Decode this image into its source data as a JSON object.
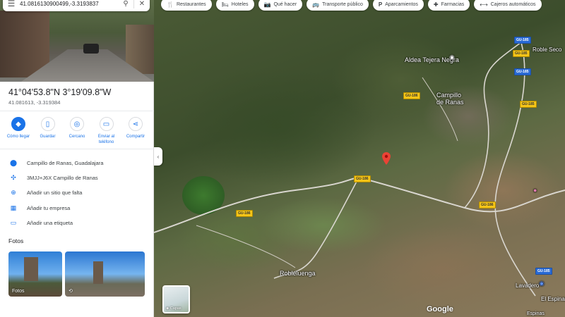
{
  "search": {
    "query": "41.0816130900499,-3.3193837"
  },
  "hero": {
    "alt": ""
  },
  "place": {
    "title": "41°04'53.8\"N 3°19'09.8\"W",
    "decimal": "41.081613, -3.319384"
  },
  "actions": [
    {
      "label": "Cómo llegar",
      "icon": "directions-icon"
    },
    {
      "label": "Guardar",
      "icon": "bookmark-icon"
    },
    {
      "label": "Cercano",
      "icon": "nearby-icon"
    },
    {
      "label": "Enviar al teléfono",
      "icon": "phone-icon"
    },
    {
      "label": "Compartir",
      "icon": "share-icon"
    }
  ],
  "info": [
    {
      "text": "Campillo de Ranas, Guadalajara",
      "icon": "location-pin-icon"
    },
    {
      "text": "3MJJ+J6X Campillo de Ranas",
      "icon": "plus-code-icon"
    },
    {
      "text": "Añadir un sitio que falta",
      "icon": "add-place-icon"
    },
    {
      "text": "Añadir tu empresa",
      "icon": "business-icon"
    },
    {
      "text": "Añadir una etiqueta",
      "icon": "label-icon"
    }
  ],
  "photos": {
    "title": "Fotos",
    "first_label": "Fotos"
  },
  "chips": [
    {
      "label": "Restaurantes",
      "icon": "restaurant-icon"
    },
    {
      "label": "Hoteles",
      "icon": "hotel-icon"
    },
    {
      "label": "Qué hacer",
      "icon": "camera-icon"
    },
    {
      "label": "Transporte público",
      "icon": "transit-icon"
    },
    {
      "label": "Aparcamientos",
      "icon": "parking-icon"
    },
    {
      "label": "Farmacias",
      "icon": "pharmacy-icon"
    },
    {
      "label": "Cajeros automáticos",
      "icon": "atm-icon"
    }
  ],
  "map": {
    "labels": {
      "aldea": "Aldea Tejera Negra",
      "campillo": "Campillo de Ranas",
      "roblelacasa": "Robleluenga",
      "robledo": "Roble Seco",
      "lavadero": "Lavadero",
      "espinar": "El Espinar",
      "espinas": "Espinas"
    },
    "roads": {
      "gu186a": "GU-186",
      "gu186b": "GU-186",
      "gu186c": "GU-186",
      "gu186d": "GU-186",
      "gu185a": "GU-185",
      "gu185b": "GU-185",
      "gu185c": "GU-185",
      "gu185d": "GU-185",
      "gu185e": "GU-185"
    },
    "layers_label": "Capas",
    "logo": "Google"
  },
  "colors": {
    "accent": "#1a73e8",
    "pin": "#ea4335"
  }
}
